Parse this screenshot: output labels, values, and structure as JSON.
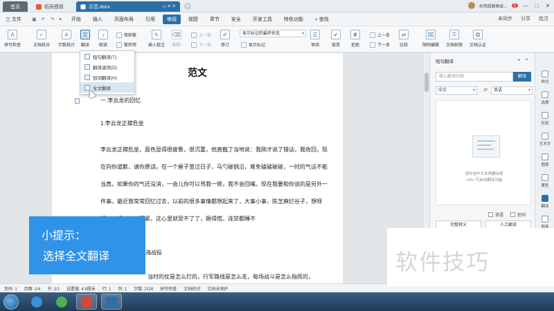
{
  "window": {
    "home_tab": "首页",
    "tabs": [
      {
        "label": "稻壳模板"
      },
      {
        "label": "示范.docx"
      }
    ],
    "user": "水鸡四娘鱼虹...",
    "badge": "1"
  },
  "menubar": {
    "file_label": "三 文件",
    "items": [
      "开始",
      "插入",
      "页面布局",
      "引用",
      "审阅",
      "视图",
      "章节",
      "安全",
      "开发工具",
      "特色功能"
    ],
    "active": "审阅",
    "search": "查找",
    "right_items": [
      "未同步",
      "分享",
      "批注"
    ]
  },
  "ribbon": {
    "spellcheck": "拼写检查",
    "doc_proof": "文档校对",
    "word_count": "字数统计",
    "translate": "翻译",
    "read_aloud": "朗读",
    "to_traditional": "简转繁",
    "to_simplified": "繁转简",
    "insert_comment": "插入批注",
    "delete": "删除",
    "prev_comment": "上一条",
    "next_comment": "下一条",
    "revise": "修订",
    "show_markup_mode": "显示标记的最终状态",
    "show_markup": "显示标记",
    "review": "审阅",
    "accept": "接受",
    "reject": "拒绝",
    "prev": "上一条",
    "next": "下一条",
    "compare": "比较",
    "restrict_edit": "限制编辑",
    "doc_permission": "文档权限",
    "doc_auth": "文档认证"
  },
  "dropdown": {
    "items": [
      {
        "label": "短句翻译(T)"
      },
      {
        "label": "翻译选项(D)"
      },
      {
        "label": "划词翻译(H)"
      },
      {
        "label": "全文翻译"
      }
    ]
  },
  "document": {
    "title": "范文",
    "heading1": "一.李云龙的回忆",
    "heading2": "1.李云龙正襟危坐",
    "paragraph": "李云龙正襟危坐，面色显得很疲惫，很沉重，他直截了当地说：我刚才说了错话，我收回，现在向你道歉，请你原谅。在一个屋子里过日子，马勺碰锅沿，难免磕磕碰碰，一时的气话不能当真，如果你的气还没消，一会儿你可以骂我一顿，我不会回嘴，现在我要和你谈的是另外一件事。最近我常常回忆过去，以前的很多事情都想起来了，大事小事，陈芝麻烂谷子，想呀想，一想过去不要紧，这心里就受不了了，揪得慌，连觉都睡不",
    "para_partial_1": "海战役",
    "para_partial_2": "当时的仗是怎么打的，行军路线是怎么走，每场战斗是怎么指挥的，"
  },
  "hint": {
    "line1": "小提示：",
    "line2": "选择全文翻译"
  },
  "right_panel": {
    "title": "短句翻译",
    "input_placeholder": "输入翻译内容",
    "translate_button": "翻译",
    "source_lang": "中文",
    "target_lang": "英语",
    "tip_line1": "请先选中文本再翻译哦",
    "tip_line2": "<F6> 可启动翻译功能",
    "check_bilingual": "双语",
    "check_word": "划词",
    "full_translate": "完整释义",
    "human_translate": "人工翻译"
  },
  "vtoolbar": {
    "items": [
      "样式",
      "选择",
      "形状",
      "艺术字",
      "图表",
      "属性",
      "翻译",
      "图表"
    ]
  },
  "statusbar": {
    "items": [
      "页码: 1",
      "页面: 1/4",
      "节: 1/1",
      "设置值: 4.8厘米",
      "行: 1",
      "列: 1",
      "字数: 2116",
      "拼写检查",
      "文档校对",
      "文档未保护"
    ]
  },
  "watermark": "软件技巧",
  "colors": {
    "accent": "#2b6fa8",
    "hint_bg": "#2f93e8"
  }
}
